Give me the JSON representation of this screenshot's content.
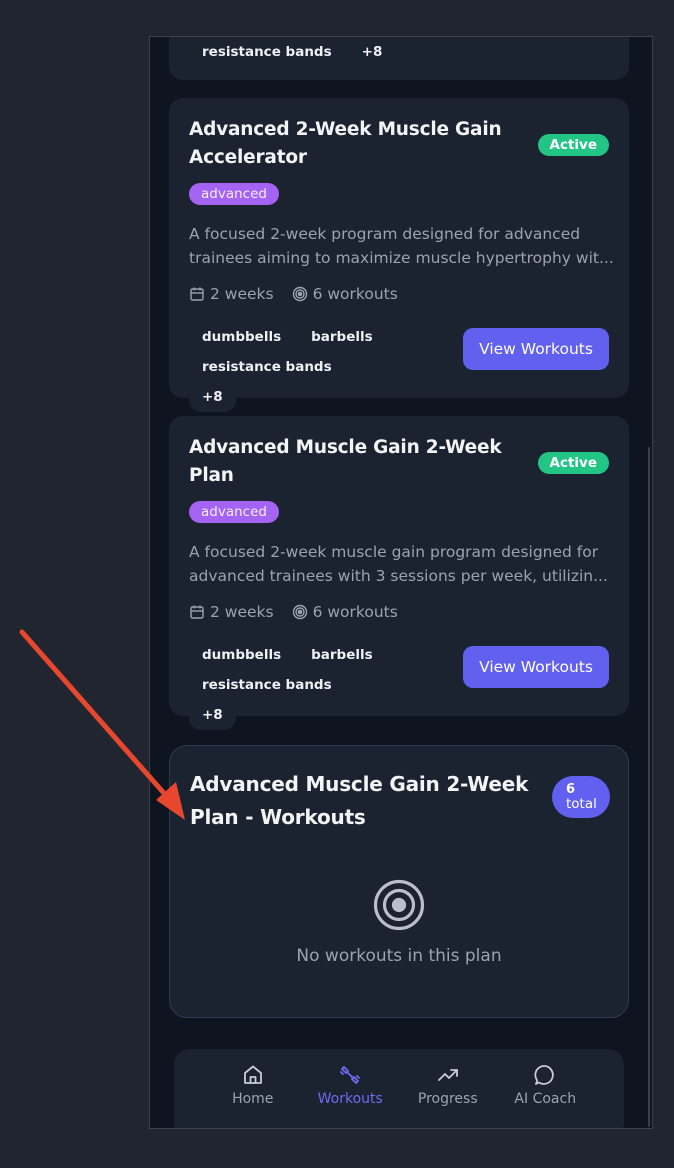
{
  "top_card": {
    "equipment": [
      "resistance bands",
      "+8"
    ]
  },
  "plans": [
    {
      "title": "Advanced 2-Week Muscle Gain Accelerator",
      "status": "Active",
      "level": "advanced",
      "description_line1": "A focused 2-week program designed for advanced",
      "description_line2": "trainees aiming to maximize muscle hypertrophy wit...",
      "duration": "2 weeks",
      "workouts": "6 workouts",
      "equipment": [
        "dumbbells",
        "barbells",
        "resistance bands",
        "+8"
      ],
      "button": "View Workouts"
    },
    {
      "title": "Advanced Muscle Gain 2-Week Plan",
      "status": "Active",
      "level": "advanced",
      "description_line1": "A focused 2-week muscle gain program designed for",
      "description_line2": "advanced trainees with 3 sessions per week, utilizin...",
      "duration": "2 weeks",
      "workouts": "6 workouts",
      "equipment": [
        "dumbbells",
        "barbells",
        "resistance bands",
        "+8"
      ],
      "button": "View Workouts"
    }
  ],
  "workouts_panel": {
    "title": "Advanced Muscle Gain 2-Week Plan - Workouts",
    "count": "6",
    "count_label": "total",
    "empty_text": "No workouts in this plan"
  },
  "nav": {
    "items": [
      {
        "label": "Home",
        "icon": "home-icon"
      },
      {
        "label": "Workouts",
        "icon": "dumbbell-icon"
      },
      {
        "label": "Progress",
        "icon": "trending-up-icon"
      },
      {
        "label": "AI Coach",
        "icon": "chat-bubble-icon"
      }
    ],
    "active": "Workouts"
  },
  "colors": {
    "accent": "#6160ef",
    "active_badge": "#22c586",
    "level_pill": "#a463f2",
    "annotation_arrow": "#e8472f"
  }
}
